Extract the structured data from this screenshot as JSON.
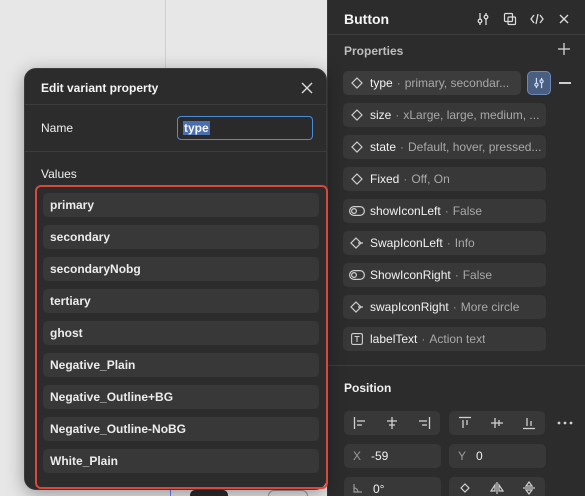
{
  "panel": {
    "title": "Button",
    "properties_title": "Properties",
    "properties": [
      {
        "name": "type",
        "value": "primary, secondar...",
        "icon": "diamond-icon"
      },
      {
        "name": "size",
        "value": "xLarge, large, medium, ...",
        "icon": "diamond-icon"
      },
      {
        "name": "state",
        "value": "Default, hover, pressed...",
        "icon": "diamond-icon"
      },
      {
        "name": "Fixed",
        "value": "Off, On",
        "icon": "diamond-icon"
      },
      {
        "name": "showIconLeft",
        "value": "False",
        "icon": "toggle-icon"
      },
      {
        "name": "SwapIconLeft",
        "value": "Info",
        "icon": "swap-instance-icon"
      },
      {
        "name": "ShowIconRight",
        "value": "False",
        "icon": "toggle-icon"
      },
      {
        "name": "swapIconRight",
        "value": "More circle",
        "icon": "swap-instance-icon"
      },
      {
        "name": "labelText",
        "value": "Action text",
        "icon": "text-icon"
      }
    ],
    "position_title": "Position",
    "x_label": "X",
    "x_value": "-59",
    "y_label": "Y",
    "y_value": "0",
    "rotation_value": "0°"
  },
  "modal": {
    "title": "Edit variant property",
    "name_label": "Name",
    "name_value": "type",
    "values_label": "Values",
    "values": [
      "primary",
      "secondary",
      "secondaryNobg",
      "tertiary",
      "ghost",
      "Negative_Plain",
      "Negative_Outline+BG",
      "Negative_Outline-NoBG",
      "White_Plain"
    ]
  },
  "colors": {
    "panel_bg": "#2c2c2c",
    "field_bg": "#383838",
    "highlight_border": "#d9483b",
    "input_focus": "#4c8dd8"
  }
}
